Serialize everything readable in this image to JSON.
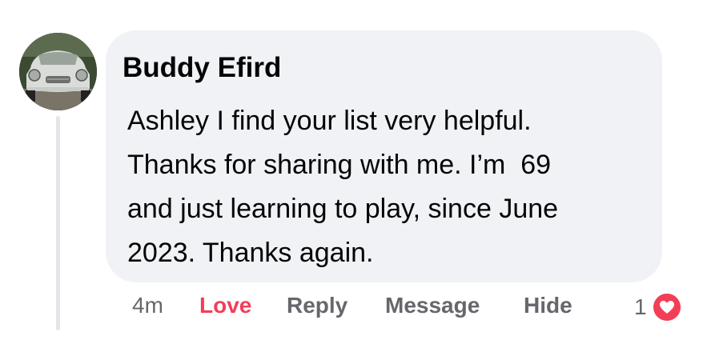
{
  "comment": {
    "author": "Buddy Efird",
    "text_lines": [
      "Ashley I find your list very helpful.",
      "Thanks for sharing with me. I’m  69",
      "and just learning to play, since June",
      "2023. Thanks again."
    ],
    "avatar_icon": "classic-car-photo"
  },
  "actions": {
    "timestamp": "4m",
    "love_label": "Love",
    "reply_label": "Reply",
    "message_label": "Message",
    "hide_label": "Hide"
  },
  "reactions": {
    "count": "1",
    "icon": "heart-icon"
  },
  "colors": {
    "bubble": "#f0f2f5",
    "love": "#f33e58",
    "muted_text": "#65676b",
    "text": "#050505"
  }
}
